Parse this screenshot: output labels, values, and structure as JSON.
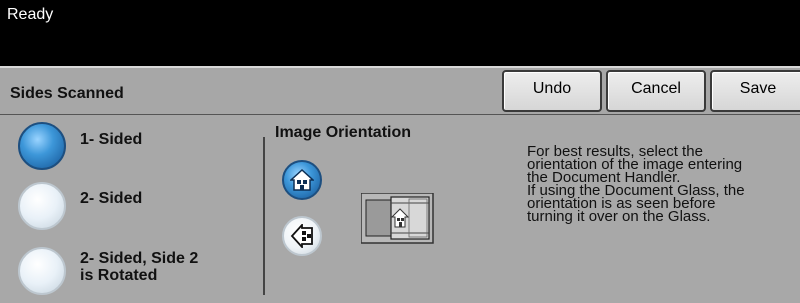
{
  "status": {
    "text": "Ready"
  },
  "header": {
    "title": "Sides Scanned",
    "buttons": {
      "undo": "Undo",
      "cancel": "Cancel",
      "save": "Save"
    }
  },
  "sides_options": [
    {
      "label": "1- Sided",
      "selected": true
    },
    {
      "label": "2- Sided",
      "selected": false
    },
    {
      "label_line1": "2- Sided, Side 2",
      "label_line2": "is Rotated",
      "selected": false
    }
  ],
  "orientation": {
    "title": "Image Orientation",
    "options": [
      {
        "icon": "upright-house-icon",
        "selected": true
      },
      {
        "icon": "sideways-house-icon",
        "selected": false
      }
    ],
    "illustration_icon": "document-handler-icon"
  },
  "info": {
    "lines": [
      "For best results, select the",
      "orientation of the image entering",
      "the Document Handler.",
      "If using the Document Glass, the",
      "orientation is as seen before",
      "turning it over on the Glass."
    ]
  },
  "colors": {
    "selected_accent": "#3d97d9",
    "panel_background": "#a8a8a8",
    "status_background": "#000000"
  }
}
